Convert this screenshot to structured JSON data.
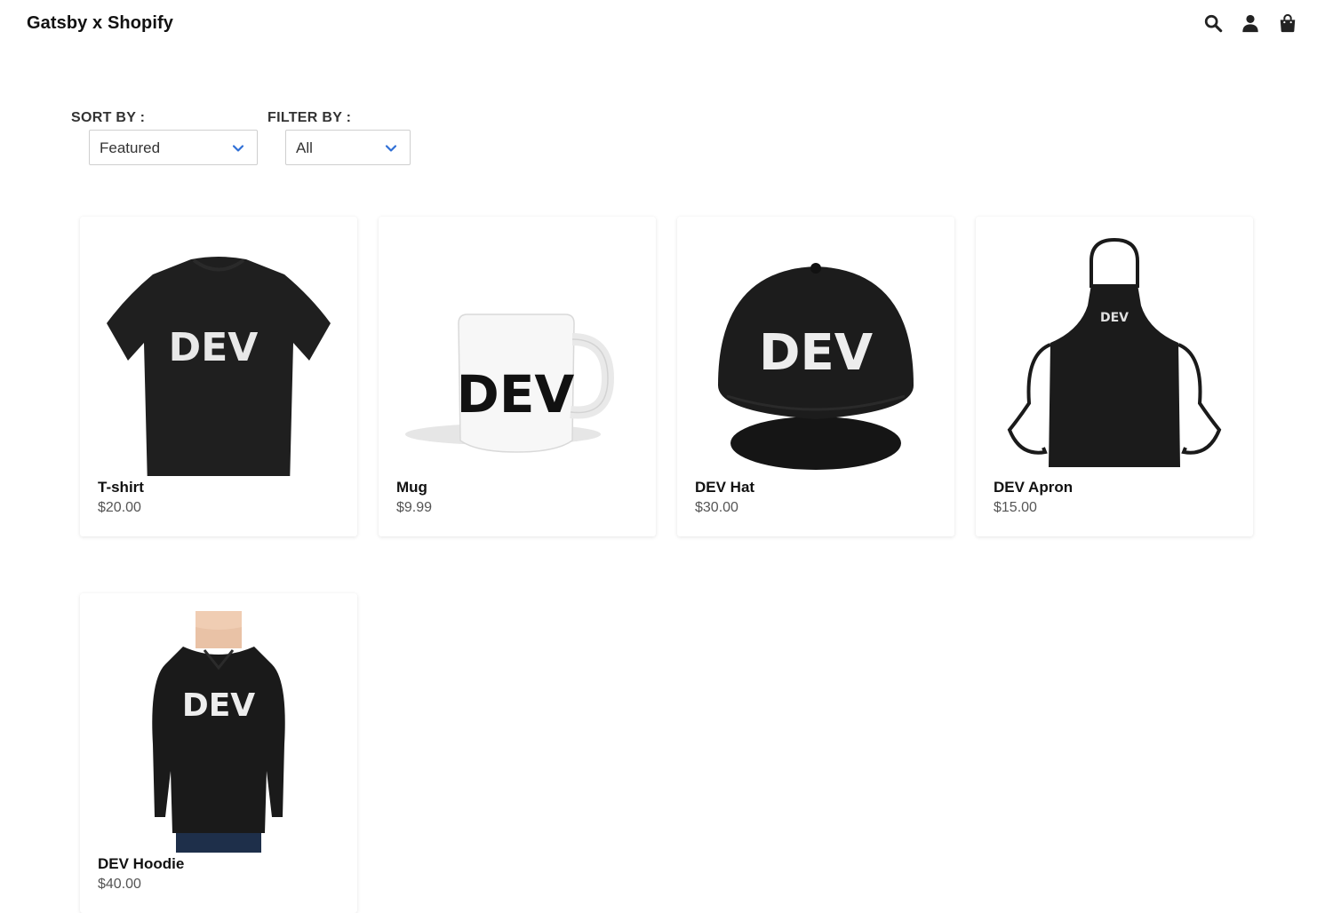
{
  "header": {
    "brand": "Gatsby x Shopify",
    "icons": [
      "search-icon",
      "user-icon",
      "shopping-bag-icon"
    ]
  },
  "controls": {
    "sort_label": "SORT BY :",
    "sort_value": "Featured",
    "filter_label": "FILTER BY :",
    "filter_value": "All"
  },
  "products": [
    {
      "name": "T-shirt",
      "price": "$20.00",
      "image_text": "DEV"
    },
    {
      "name": "Mug",
      "price": "$9.99",
      "image_text": "DEV"
    },
    {
      "name": "DEV Hat",
      "price": "$30.00",
      "image_text": "DEV"
    },
    {
      "name": "DEV Apron",
      "price": "$15.00",
      "image_text": "DEV"
    },
    {
      "name": "DEV Hoodie",
      "price": "$40.00",
      "image_text": "DEV"
    }
  ],
  "colors": {
    "accent": "#2f6fd6",
    "text": "#111111",
    "muted": "#555555",
    "border": "#cfcfcf"
  }
}
